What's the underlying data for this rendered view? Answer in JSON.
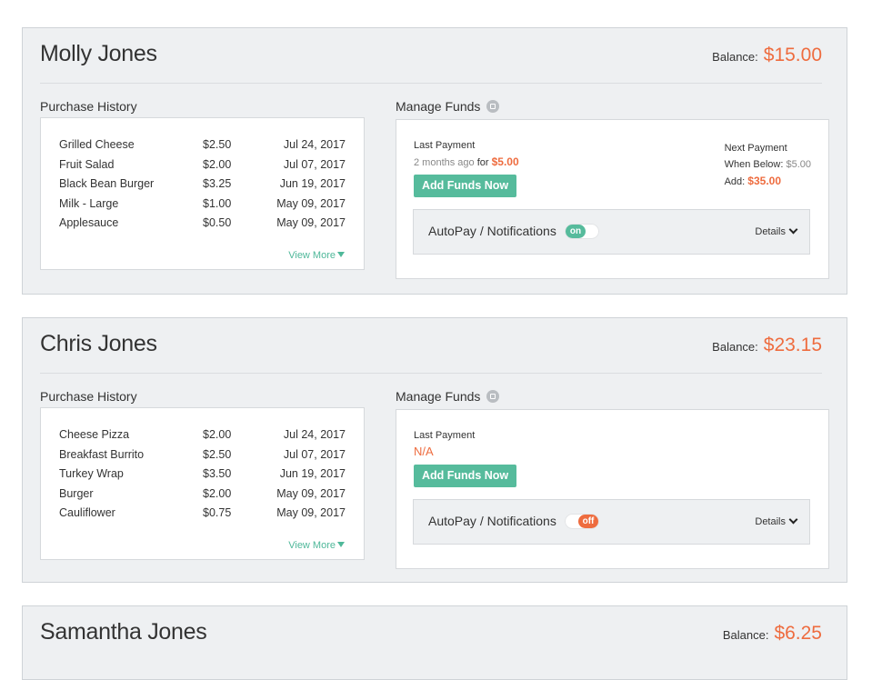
{
  "accent_color": "#ee6c3f",
  "button_color": "#56bb9c",
  "balance_label": "Balance:",
  "purchase_history_title": "Purchase History",
  "manage_funds_title": "Manage Funds",
  "last_payment_label": "Last Payment",
  "next_payment_label": "Next Payment",
  "add_funds_label": "Add Funds Now",
  "autopay_label": "AutoPay / Notifications",
  "details_label": "Details",
  "view_more_label": "View More",
  "students": [
    {
      "name": "Molly Jones",
      "balance": "$15.00",
      "purchases": [
        {
          "item": "Grilled Cheese",
          "price": "$2.50",
          "date": "Jul 24, 2017"
        },
        {
          "item": "Fruit Salad",
          "price": "$2.00",
          "date": "Jul 07, 2017"
        },
        {
          "item": "Black Bean Burger",
          "price": "$3.25",
          "date": "Jun 19, 2017"
        },
        {
          "item": "Milk - Large",
          "price": "$1.00",
          "date": "May 09, 2017"
        },
        {
          "item": "Applesauce",
          "price": "$0.50",
          "date": "May 09, 2017"
        }
      ],
      "last_payment_ago": "2 months ago",
      "last_payment_for": "for",
      "last_payment_amount": "$5.00",
      "next_when_below_label": "When Below:",
      "next_when_below_value": "$5.00",
      "next_add_label": "Add:",
      "next_add_value": "$35.00",
      "autopay_state": "on"
    },
    {
      "name": "Chris Jones",
      "balance": "$23.15",
      "purchases": [
        {
          "item": "Cheese Pizza",
          "price": "$2.00",
          "date": "Jul 24, 2017"
        },
        {
          "item": "Breakfast Burrito",
          "price": "$2.50",
          "date": "Jul 07, 2017"
        },
        {
          "item": "Turkey Wrap",
          "price": "$3.50",
          "date": "Jun 19, 2017"
        },
        {
          "item": "Burger",
          "price": "$2.00",
          "date": "May 09, 2017"
        },
        {
          "item": "Cauliflower",
          "price": "$0.75",
          "date": "May 09, 2017"
        }
      ],
      "last_payment_na": "N/A",
      "autopay_state": "off"
    },
    {
      "name": "Samantha Jones",
      "balance": "$6.25"
    }
  ]
}
